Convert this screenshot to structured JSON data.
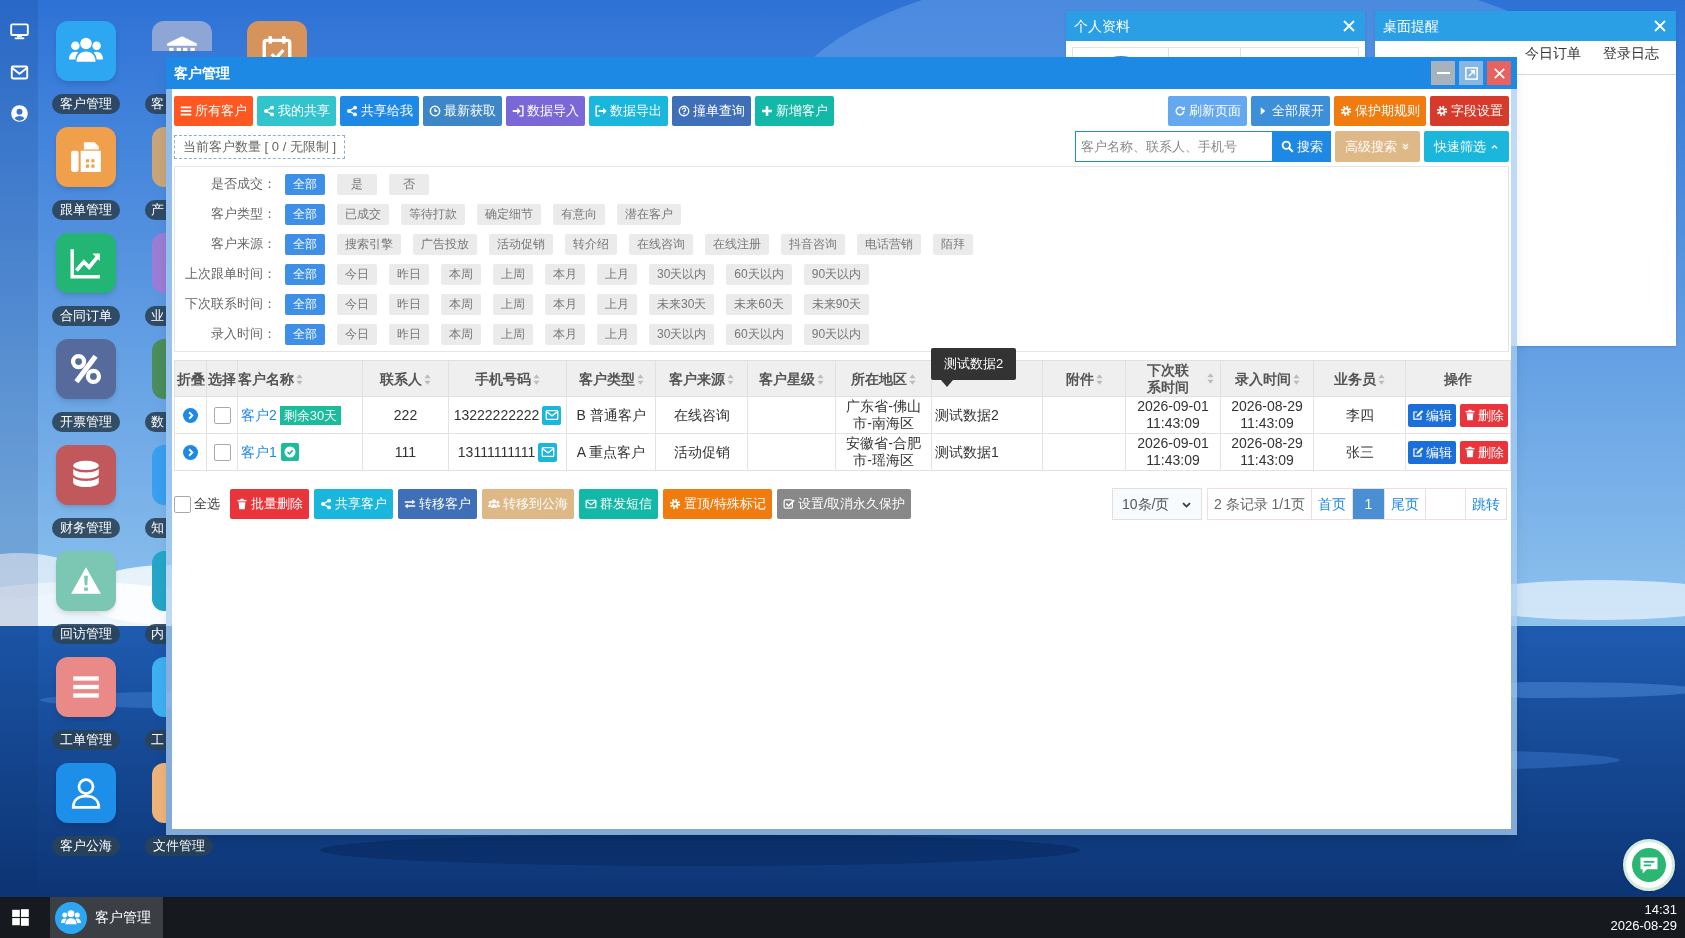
{
  "desktop": {
    "apps": [
      {
        "label": "客户管理",
        "color": "#2ea7f2"
      },
      {
        "label": "跟单管理",
        "color": "#f0a04b"
      },
      {
        "label": "合同订单",
        "color": "#22b573"
      },
      {
        "label": "开票管理",
        "color": "#566b9c"
      },
      {
        "label": "财务管理",
        "color": "#c0585c"
      },
      {
        "label": "回访管理",
        "color": "#7cc7b3"
      },
      {
        "label": "工单管理",
        "color": "#e98a89"
      },
      {
        "label": "客户公海",
        "color": "#1e8fe8"
      }
    ],
    "apps_column_2": [
      {
        "label": "客",
        "color": "#8ea6d6"
      },
      {
        "label": "产",
        "color": "#c9a67a"
      },
      {
        "label": "业",
        "color": "#9b7dd6"
      },
      {
        "label": "数",
        "color": "#4b8d5c"
      },
      {
        "label": "知",
        "color": "#3a9ff0"
      },
      {
        "label": "内",
        "color": "#25a6c9"
      },
      {
        "label": "工",
        "color": "#3db0f2"
      },
      {
        "label": "文件管理",
        "color": "#efb37a"
      }
    ],
    "apps_column_3": [
      {
        "color": "#d6935c"
      }
    ]
  },
  "profile_window": {
    "title": "个人资料"
  },
  "reminder_window": {
    "title": "桌面提醒",
    "tabs": [
      {
        "label": "今日订单",
        "selected": false
      },
      {
        "label": "登录日志",
        "selected": false
      }
    ]
  },
  "main_window": {
    "title": "客户管理",
    "toolbar_left": [
      {
        "label": "所有客户",
        "color": "#ff5722"
      },
      {
        "label": "我的共享",
        "color": "#33c3cc"
      },
      {
        "label": "共享给我",
        "color": "#1e88e5"
      },
      {
        "label": "最新获取",
        "color": "#3f86c6"
      },
      {
        "label": "数据导入",
        "color": "#7b68d8"
      },
      {
        "label": "数据导出",
        "color": "#1ab6dc"
      },
      {
        "label": "撞单查询",
        "color": "#3f6fb6"
      },
      {
        "label": "新增客户",
        "color": "#14b8a6"
      }
    ],
    "toolbar_right": [
      {
        "label": "刷新页面",
        "color": "#64a8f0"
      },
      {
        "label": "全部展开",
        "color": "#3d8fd8"
      },
      {
        "label": "保护期规则",
        "color": "#f07b0f"
      },
      {
        "label": "字段设置",
        "color": "#d63a2a"
      }
    ],
    "quota": "当前客户数量 [ 0 / 无限制 ]",
    "search": {
      "placeholder": "客户名称、联系人、手机号",
      "button": "搜索"
    },
    "advanced_search": "高级搜索",
    "quick_filter": "快速筛选",
    "filters": [
      {
        "label": "是否成交：",
        "options": [
          {
            "label": "全部",
            "selected": true
          },
          {
            "label": "是",
            "selected": false
          },
          {
            "label": "否",
            "selected": false
          }
        ]
      },
      {
        "label": "客户类型：",
        "options": [
          {
            "label": "全部",
            "selected": true
          },
          {
            "label": "已成交",
            "selected": false
          },
          {
            "label": "等待打款",
            "selected": false
          },
          {
            "label": "确定细节",
            "selected": false
          },
          {
            "label": "有意向",
            "selected": false
          },
          {
            "label": "潜在客户",
            "selected": false
          }
        ]
      },
      {
        "label": "客户来源：",
        "options": [
          {
            "label": "全部",
            "selected": true
          },
          {
            "label": "搜索引擎",
            "selected": false
          },
          {
            "label": "广告投放",
            "selected": false
          },
          {
            "label": "活动促销",
            "selected": false
          },
          {
            "label": "转介绍",
            "selected": false
          },
          {
            "label": "在线咨询",
            "selected": false
          },
          {
            "label": "在线注册",
            "selected": false
          },
          {
            "label": "抖音咨询",
            "selected": false
          },
          {
            "label": "电话营销",
            "selected": false
          },
          {
            "label": "陌拜",
            "selected": false
          }
        ]
      },
      {
        "label": "上次跟单时间：",
        "options": [
          {
            "label": "全部",
            "selected": true
          },
          {
            "label": "今日",
            "selected": false
          },
          {
            "label": "昨日",
            "selected": false
          },
          {
            "label": "本周",
            "selected": false
          },
          {
            "label": "上周",
            "selected": false
          },
          {
            "label": "本月",
            "selected": false
          },
          {
            "label": "上月",
            "selected": false
          },
          {
            "label": "30天以内",
            "selected": false
          },
          {
            "label": "60天以内",
            "selected": false
          },
          {
            "label": "90天以内",
            "selected": false
          }
        ]
      },
      {
        "label": "下次联系时间：",
        "options": [
          {
            "label": "全部",
            "selected": true
          },
          {
            "label": "今日",
            "selected": false
          },
          {
            "label": "昨日",
            "selected": false
          },
          {
            "label": "本周",
            "selected": false
          },
          {
            "label": "上周",
            "selected": false
          },
          {
            "label": "本月",
            "selected": false
          },
          {
            "label": "上月",
            "selected": false
          },
          {
            "label": "未来30天",
            "selected": false
          },
          {
            "label": "未来60天",
            "selected": false
          },
          {
            "label": "未来90天",
            "selected": false
          }
        ]
      },
      {
        "label": "录入时间：",
        "options": [
          {
            "label": "全部",
            "selected": true
          },
          {
            "label": "今日",
            "selected": false
          },
          {
            "label": "昨日",
            "selected": false
          },
          {
            "label": "本周",
            "selected": false
          },
          {
            "label": "上周",
            "selected": false
          },
          {
            "label": "本月",
            "selected": false
          },
          {
            "label": "上月",
            "selected": false
          },
          {
            "label": "30天以内",
            "selected": false
          },
          {
            "label": "60天以内",
            "selected": false
          },
          {
            "label": "90天以内",
            "selected": false
          }
        ]
      }
    ],
    "table": {
      "columns": [
        {
          "label": "折叠",
          "sortable": false
        },
        {
          "label": "选择",
          "sortable": false
        },
        {
          "label": "客户名称",
          "sortable": true
        },
        {
          "label": "联系人",
          "sortable": true
        },
        {
          "label": "手机号码",
          "sortable": true
        },
        {
          "label": "客户类型",
          "sortable": true
        },
        {
          "label": "客户来源",
          "sortable": true
        },
        {
          "label": "客户星级",
          "sortable": true
        },
        {
          "label": "所在地区",
          "sortable": true
        },
        {
          "sortable": false
        },
        {
          "label": "附件",
          "sortable": true
        },
        {
          "label": "下次联系时间",
          "sortable": true
        },
        {
          "label": "录入时间",
          "sortable": true
        },
        {
          "label": "业务员",
          "sortable": true
        },
        {
          "label": "操作",
          "sortable": false
        }
      ],
      "rows": [
        {
          "expanded": false,
          "selected": false,
          "name": "客户2",
          "tag": {
            "kind": "text",
            "text": "剩余30天"
          },
          "contact": "222",
          "phone": "13222222222",
          "type": "B 普通客户",
          "source": "在线咨询",
          "region": "广东省-佛山市-南海区",
          "column_10": "测试数据2",
          "next_contact": "2026-09-01 11:43:09",
          "created": "2026-08-29 11:43:09",
          "owner": "李四",
          "actions": [
            "编辑",
            "删除"
          ]
        },
        {
          "expanded": false,
          "selected": false,
          "name": "客户1",
          "tag": {
            "kind": "check"
          },
          "contact": "111",
          "phone": "13111111111",
          "type": "A 重点客户",
          "source": "活动促销",
          "region": "安徽省-合肥市-瑶海区",
          "column_10": "测试数据1",
          "next_contact": "2026-09-01 11:43:09",
          "created": "2026-08-29 11:43:09",
          "owner": "张三",
          "actions": [
            "编辑",
            "删除"
          ]
        }
      ]
    },
    "tooltip": "测试数据2",
    "select_all": {
      "label": "全选",
      "checked": false
    },
    "bulk_actions": [
      {
        "label": "批量删除",
        "color": "#e8343a"
      },
      {
        "label": "共享客户",
        "color": "#1ab6dc"
      },
      {
        "label": "转移客户",
        "color": "#3f6fb6"
      },
      {
        "label": "转移到公海",
        "color": "#deb887"
      },
      {
        "label": "群发短信",
        "color": "#14b8a6"
      },
      {
        "label": "置顶/特殊标记",
        "color": "#f07b0f"
      },
      {
        "label": "设置/取消永久保护",
        "color": "#888888"
      }
    ],
    "pagination": {
      "per_page": "10条/页",
      "summary": "2 条记录 1/1页",
      "first": "首页",
      "pages": [
        {
          "label": "1",
          "selected": true
        }
      ],
      "last": "尾页",
      "jump": "跳转"
    }
  },
  "taskbar": {
    "task": "客户管理",
    "time": "14:31",
    "date": "2026-08-29"
  }
}
